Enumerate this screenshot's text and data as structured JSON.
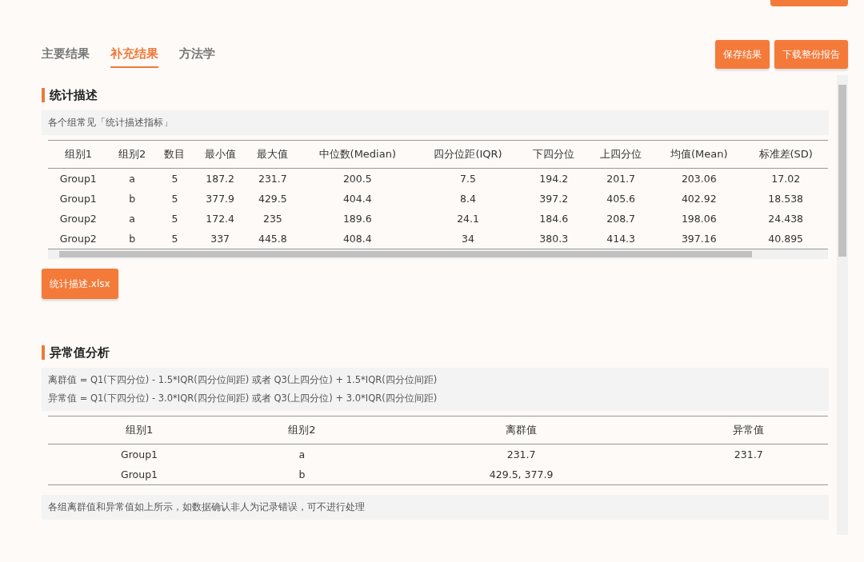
{
  "tabs": [
    {
      "label": "主要结果",
      "selected": false
    },
    {
      "label": "补充结果",
      "selected": true
    },
    {
      "label": "方法学",
      "selected": false
    }
  ],
  "actions": [
    "保存结果",
    "下载整份报告"
  ],
  "sections": [
    {
      "title": "统计描述",
      "notes": [
        "各个组常见「统计描述指标」"
      ],
      "table": {
        "columns": [
          "组别1",
          "组别2",
          "数目",
          "最小值",
          "最大值",
          "中位数(Median)",
          "四分位距(IQR)",
          "下四分位",
          "上四分位",
          "均值(Mean)",
          "标准差(SD)"
        ],
        "rows": [
          [
            "Group1",
            "a",
            "5",
            "187.2",
            "231.7",
            "200.5",
            "7.5",
            "194.2",
            "201.7",
            "203.06",
            "17.02"
          ],
          [
            "Group1",
            "b",
            "5",
            "377.9",
            "429.5",
            "404.4",
            "8.4",
            "397.2",
            "405.6",
            "402.92",
            "18.538"
          ],
          [
            "Group2",
            "a",
            "5",
            "172.4",
            "235",
            "189.6",
            "24.1",
            "184.6",
            "208.7",
            "198.06",
            "24.438"
          ],
          [
            "Group2",
            "b",
            "5",
            "337",
            "445.8",
            "408.4",
            "34",
            "380.3",
            "414.3",
            "397.16",
            "40.895"
          ]
        ]
      },
      "download": "统计描述.xlsx"
    },
    {
      "title": "异常值分析",
      "notes": [
        "离群值 = Q1(下四分位) - 1.5*IQR(四分位间距) 或者 Q3(上四分位) + 1.5*IQR(四分位间距)",
        "异常值 = Q1(下四分位) - 3.0*IQR(四分位间距) 或者 Q3(上四分位) + 3.0*IQR(四分位间距)"
      ],
      "table": {
        "columns": [
          "组别1",
          "组别2",
          "离群值",
          "异常值"
        ],
        "rows": [
          [
            "Group1",
            "a",
            "231.7",
            "231.7"
          ],
          [
            "Group1",
            "b",
            "429.5, 377.9",
            ""
          ]
        ]
      },
      "footer": "各组离群值和异常值如上所示，如数据确认非人为记录错误，可不进行处理"
    }
  ]
}
